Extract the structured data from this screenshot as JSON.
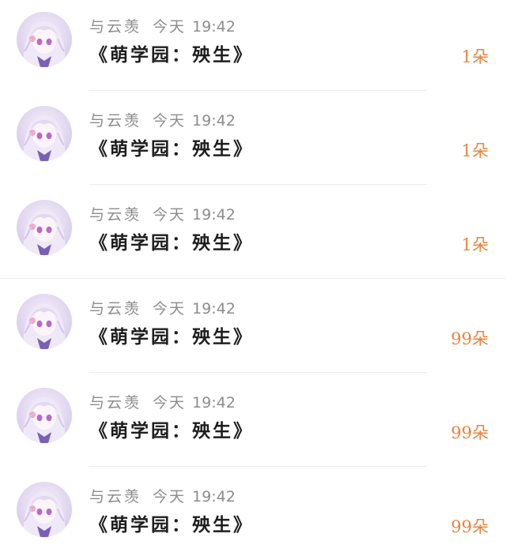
{
  "items": [
    {
      "name": "与云羡",
      "day": "今天",
      "time": "19:42",
      "title": "《萌学园：殃生》",
      "amount": "1朵"
    },
    {
      "name": "与云羡",
      "day": "今天",
      "time": "19:42",
      "title": "《萌学园：殃生》",
      "amount": "1朵"
    },
    {
      "name": "与云羡",
      "day": "今天",
      "time": "19:42",
      "title": "《萌学园：殃生》",
      "amount": "1朵"
    },
    {
      "name": "与云羡",
      "day": "今天",
      "time": "19:42",
      "title": "《萌学园：殃生》",
      "amount": "99朵"
    },
    {
      "name": "与云羡",
      "day": "今天",
      "time": "19:42",
      "title": "《萌学园：殃生》",
      "amount": "99朵"
    },
    {
      "name": "与云羡",
      "day": "今天",
      "time": "19:42",
      "title": "《萌学园：殃生》",
      "amount": "99朵"
    }
  ],
  "colors": {
    "amount": "#e8833a",
    "meta": "#8c8c8c",
    "title": "#1e1e1e",
    "avatar_tint": "#cdbfe2"
  },
  "icons": {
    "avatar": "anime-girl-avatar-icon"
  }
}
